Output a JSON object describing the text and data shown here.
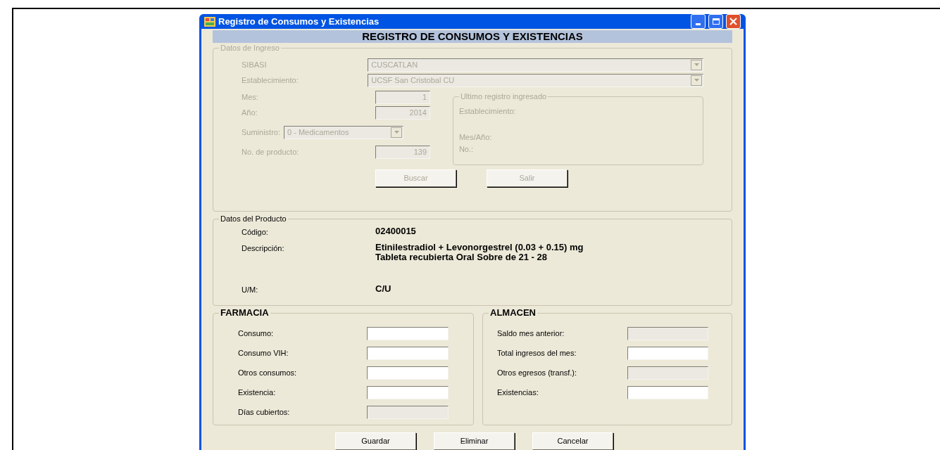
{
  "window": {
    "title": "Registro de Consumos y Existencias"
  },
  "header": "REGISTRO DE CONSUMOS Y EXISTENCIAS",
  "datos_ingreso": {
    "title": "Datos de Ingreso",
    "disabled": true,
    "fields": [
      {
        "label": "SIBASI",
        "value": "CUSCATLAN",
        "kind": "combo"
      },
      {
        "label": "Establecimiento:",
        "value": "UCSF San Cristobal CU",
        "kind": "combo"
      }
    ],
    "left_fields": [
      {
        "label": "Mes:",
        "value": "1",
        "kind": "text"
      },
      {
        "label": "Año:",
        "value": "2014",
        "kind": "text"
      },
      {
        "label": "Suministro:",
        "value": "0 - Medicamentos",
        "kind": "combo"
      },
      {
        "label": "No. de producto:",
        "value": "139",
        "kind": "text"
      }
    ],
    "ultimo": {
      "title": "Ultimo registro ingresado",
      "labels": [
        "Establecimiento:",
        "Mes/Año:",
        "No.:"
      ]
    },
    "buttons": [
      "Buscar",
      "Salir"
    ]
  },
  "producto": {
    "title": "Datos del Producto",
    "rows": [
      {
        "label": "Código:",
        "value": [
          "02400015"
        ]
      },
      {
        "label": "Descripción:",
        "value": [
          "Etinilestradiol + Levonorgestrel (0.03 + 0.15) mg",
          "Tableta recubierta Oral Sobre de 21 - 28"
        ]
      },
      {
        "label": "U/M:",
        "value": [
          "C/U"
        ]
      }
    ]
  },
  "farmacia": {
    "title": "FARMACIA",
    "fields": [
      {
        "label": "Consumo:",
        "disabled": false
      },
      {
        "label": "Consumo VIH:",
        "disabled": false
      },
      {
        "label": "Otros consumos:",
        "disabled": false
      },
      {
        "label": "Existencia:",
        "disabled": false
      },
      {
        "label": "Días cubiertos:",
        "disabled": true
      }
    ]
  },
  "almacen": {
    "title": "ALMACEN",
    "fields": [
      {
        "label": "Saldo mes anterior:",
        "disabled": true
      },
      {
        "label": "Total ingresos del mes:",
        "disabled": false
      },
      {
        "label": "Otros egresos (transf.):",
        "disabled": true
      },
      {
        "label": "Existencias:",
        "disabled": false
      }
    ]
  },
  "buttons": [
    "Guardar",
    "Eliminar",
    "Cancelar"
  ]
}
